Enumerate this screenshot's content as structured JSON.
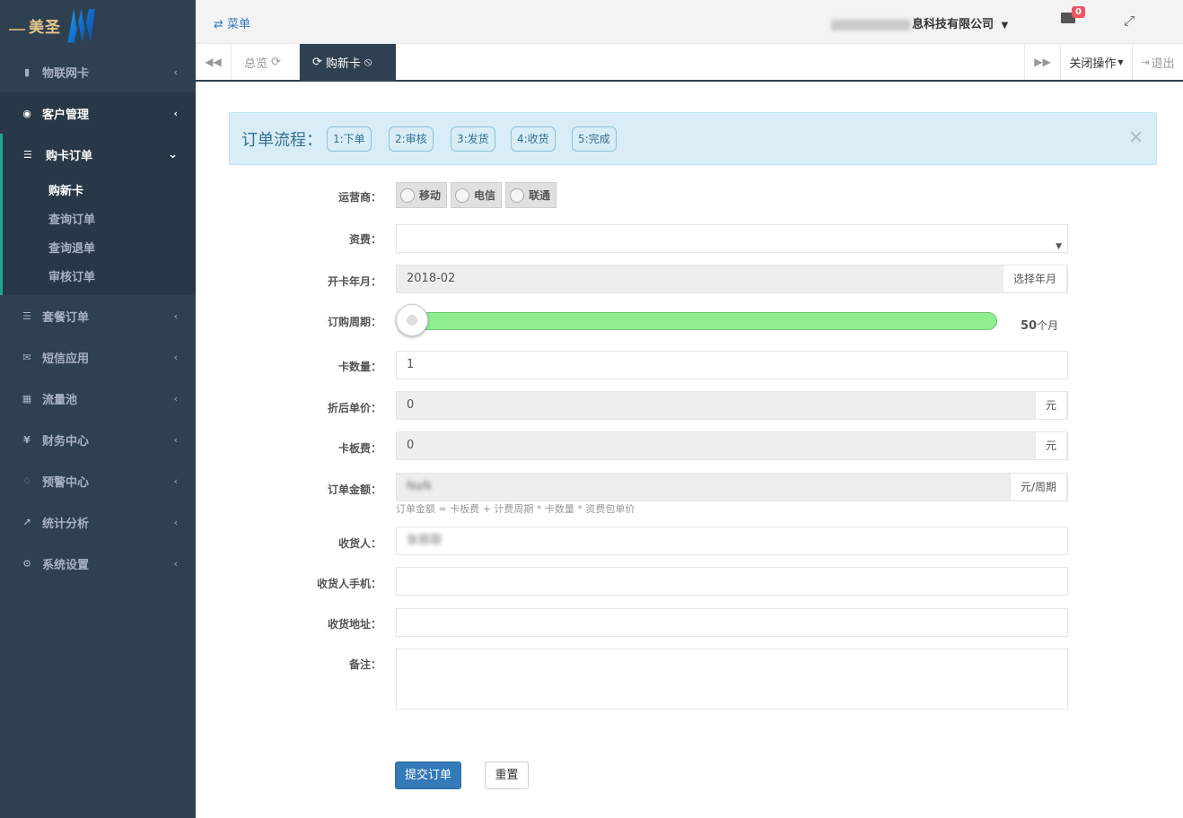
{
  "brand": {
    "logo_text": "美圣"
  },
  "sidebar": {
    "items": [
      {
        "label": "物联网卡",
        "icon": "sim-card-icon"
      },
      {
        "label": "客户管理",
        "icon": "user-circle-icon"
      },
      {
        "label": "套餐订单",
        "icon": "list-icon"
      },
      {
        "label": "短信应用",
        "icon": "envelope-icon"
      },
      {
        "label": "流量池",
        "icon": "grid-icon"
      },
      {
        "label": "财务中心",
        "icon": "yen-icon"
      },
      {
        "label": "预警中心",
        "icon": "bell-icon"
      },
      {
        "label": "统计分析",
        "icon": "line-chart-icon"
      },
      {
        "label": "系统设置",
        "icon": "gear-icon"
      }
    ],
    "submenu": {
      "title": "购卡订单",
      "links": [
        "购新卡",
        "查询订单",
        "查询退单",
        "审核订单"
      ]
    }
  },
  "header": {
    "menu_toggle": "菜单",
    "company": "息科技有限公司",
    "mail_count": "0"
  },
  "tabs": {
    "items": [
      {
        "label": "总览"
      },
      {
        "label": "购新卡"
      }
    ],
    "close_ops": "关闭操作",
    "logout": "退出"
  },
  "flow": {
    "title": "订单流程：",
    "steps": [
      "1:下单",
      "2:审核",
      "3:发货",
      "4:收货",
      "5:完成"
    ]
  },
  "form": {
    "carrier": {
      "label": "运营商：",
      "options": [
        "移动",
        "电信",
        "联通"
      ]
    },
    "tariff": {
      "label": "资费：",
      "value": ""
    },
    "open_month": {
      "label": "开卡年月：",
      "value": "2018-02",
      "button": "选择年月"
    },
    "period": {
      "label": "订购周期：",
      "value": "50",
      "unit": "个月",
      "fraction": 0.0
    },
    "quantity": {
      "label": "卡数量：",
      "value": "1"
    },
    "unit_price": {
      "label": "折后单价：",
      "value": "0",
      "unit": "元"
    },
    "card_fee": {
      "label": "卡板费：",
      "value": "0",
      "unit": "元"
    },
    "order_amount": {
      "label": "订单金额：",
      "value": "NaN",
      "unit": "元/周期",
      "help": "订单金额 = 卡板费 + 计费周期 * 卡数量 * 资费包单价"
    },
    "receiver": {
      "label": "收货人：",
      "value": "张丽丽"
    },
    "receiver_phone": {
      "label": "收货人手机：",
      "value": ""
    },
    "address": {
      "label": "收货地址：",
      "value": ""
    },
    "remark": {
      "label": "备注：",
      "value": ""
    }
  },
  "actions": {
    "submit": "提交订单",
    "reset": "重置"
  },
  "colors": {
    "sidebar": "#2f4050",
    "accent": "#19aa8d",
    "primary": "#337ab7",
    "slider": "#90ee90",
    "badge": "#ed5565"
  }
}
